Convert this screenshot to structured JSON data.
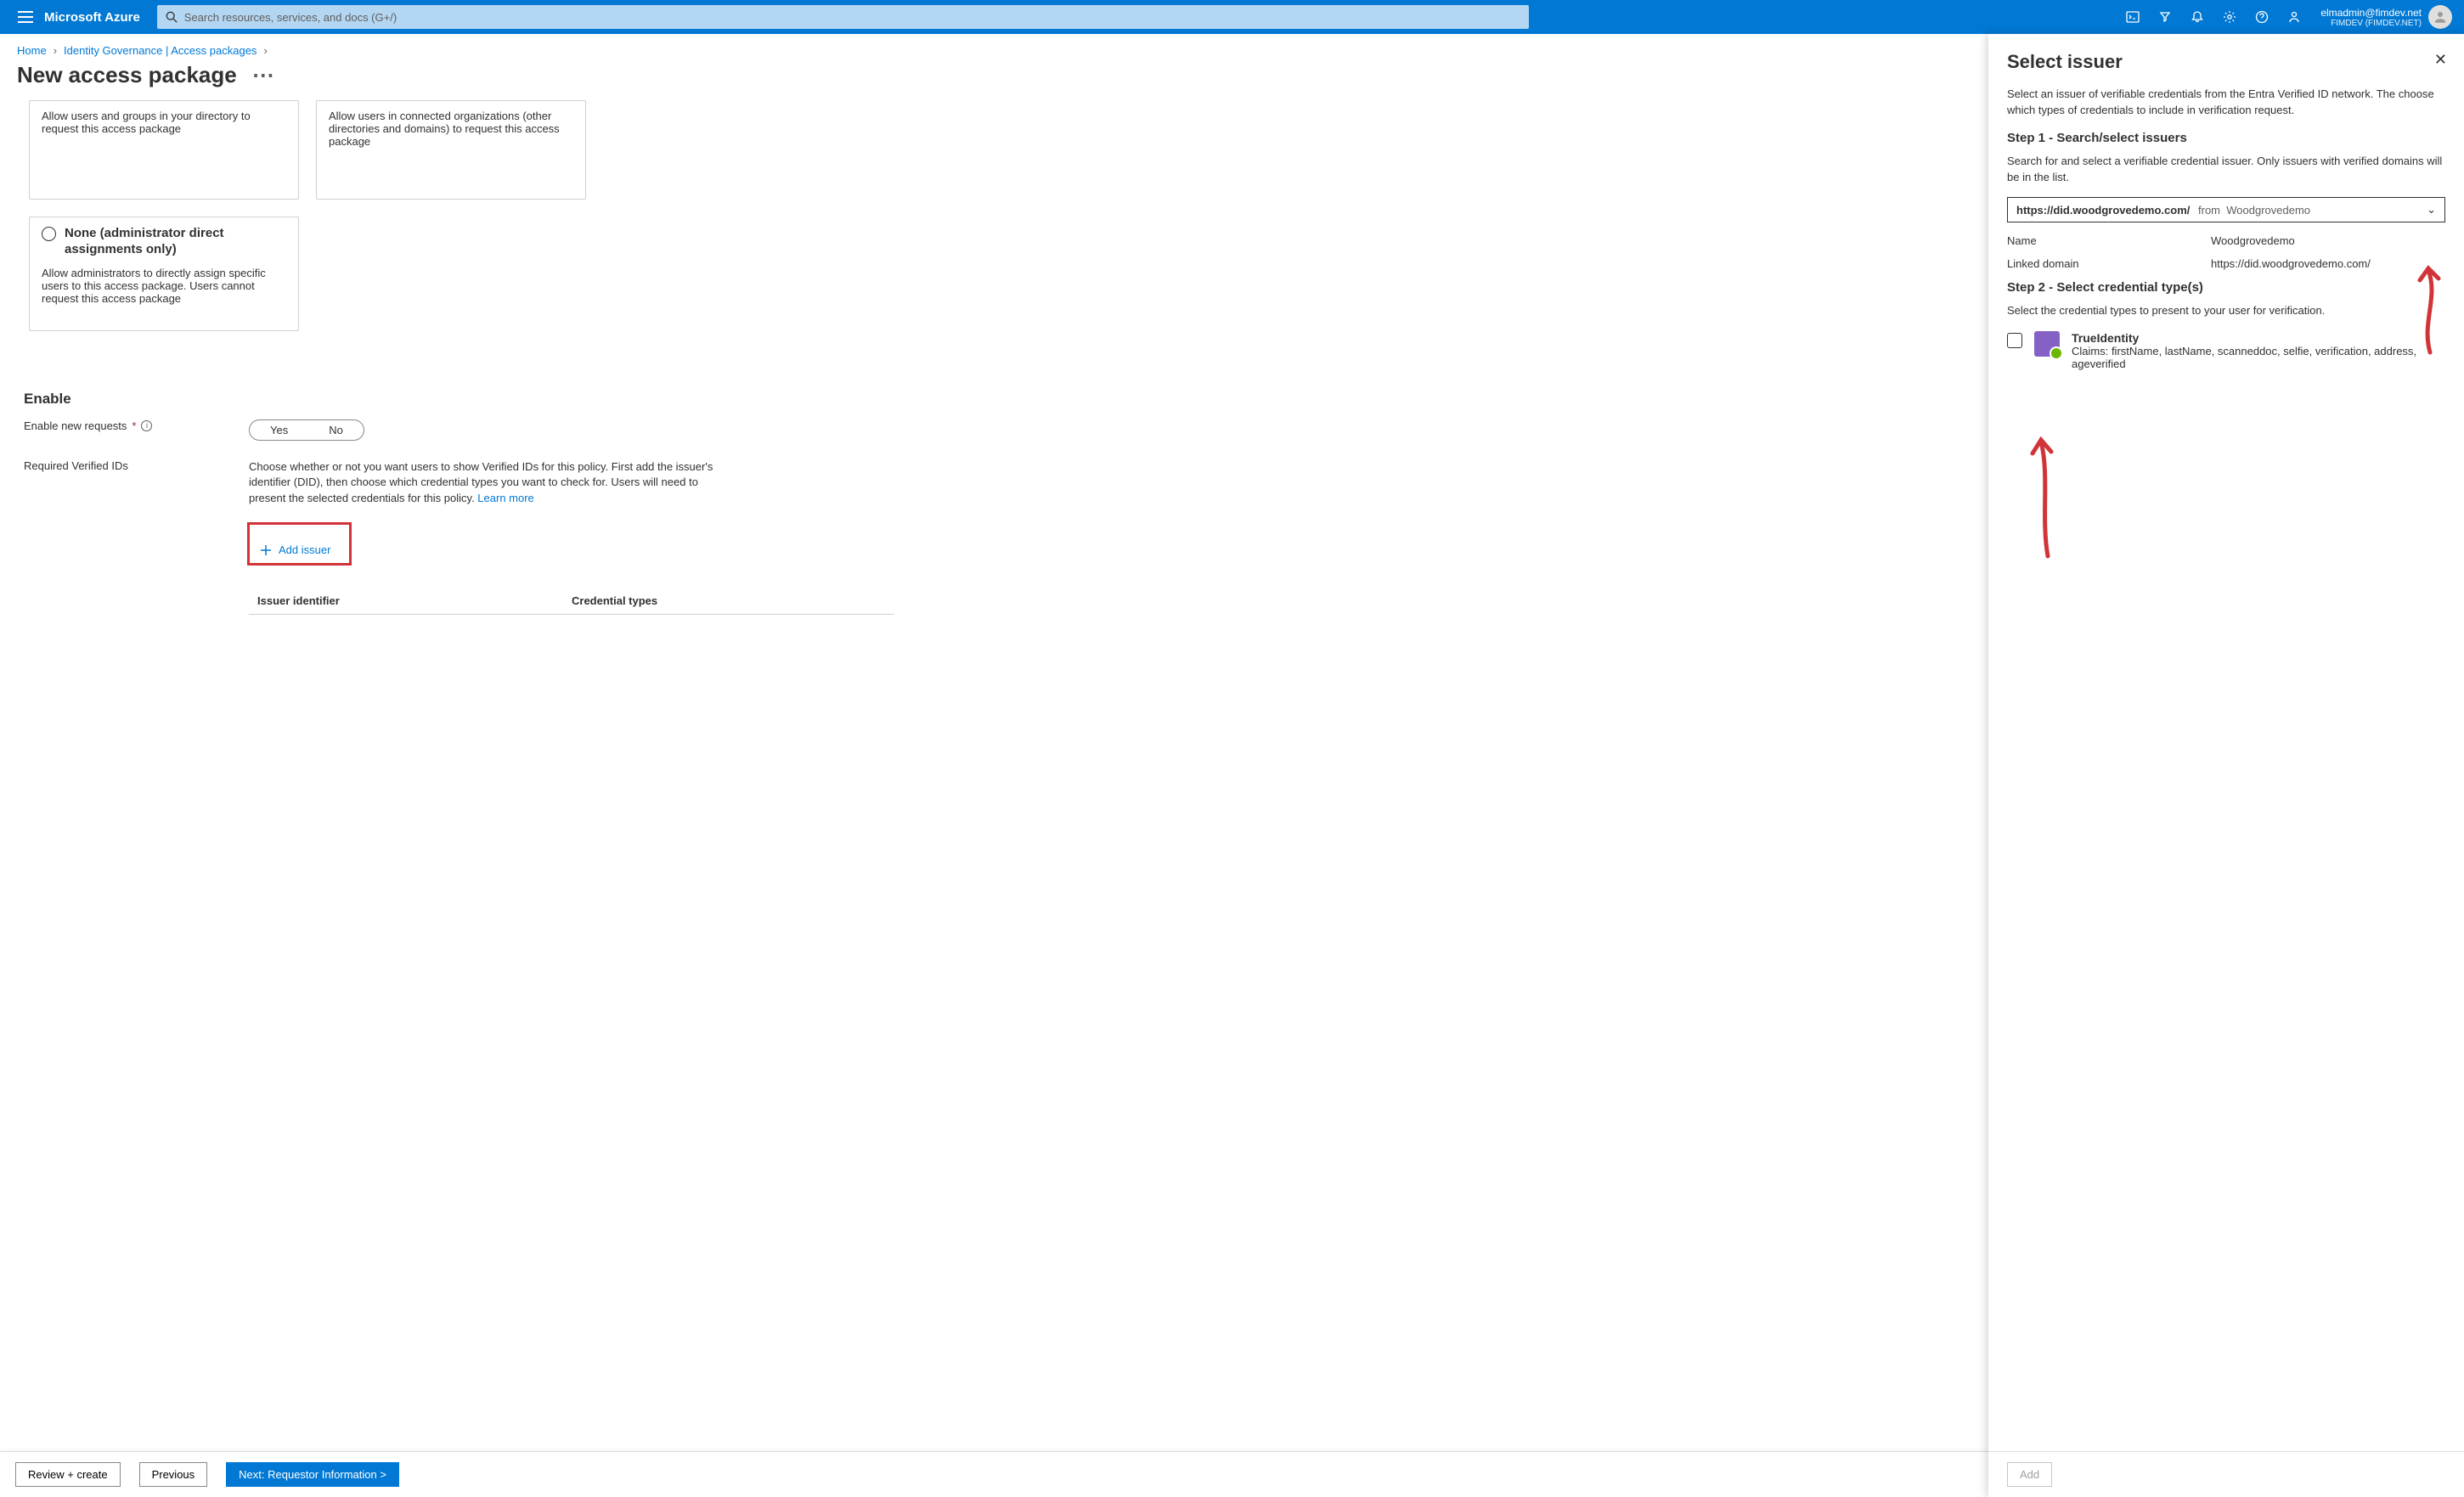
{
  "topbar": {
    "brand": "Microsoft Azure",
    "search_placeholder": "Search resources, services, and docs (G+/)",
    "account_email": "elmadmin@fimdev.net",
    "account_tenant": "FIMDEV (FIMDEV.NET)"
  },
  "breadcrumbs": {
    "home": "Home",
    "l1": "Identity Governance | Access packages"
  },
  "page_title": "New access package",
  "cards": {
    "c1_body": "Allow users and groups in your directory to request this access package",
    "c2_body": "Allow users in connected organizations (other directories and domains) to request this access package",
    "c3_title": "None (administrator direct assignments only)",
    "c3_body": "Allow administrators to directly assign specific users to this access package. Users cannot request this access package"
  },
  "enable": {
    "section": "Enable",
    "row1_label": "Enable new requests",
    "yes": "Yes",
    "no": "No",
    "row2_label": "Required Verified IDs",
    "desc_a": "Choose whether or not you want users to show Verified IDs for this policy. First add the issuer's identifier (DID), then choose which credential types you want to check for. Users will need to present the selected credentials for this policy. ",
    "learn": "Learn more",
    "add_issuer": "Add issuer",
    "col1": "Issuer identifier",
    "col2": "Credential types"
  },
  "footer": {
    "review": "Review + create",
    "prev": "Previous",
    "next": "Next: Requestor Information >"
  },
  "panel": {
    "title": "Select issuer",
    "intro": "Select an issuer of verifiable credentials from the Entra Verified ID network. The choose which types of credentials to include in verification request.",
    "step1": "Step 1 - Search/select issuers",
    "step1_desc": "Search for and select a verifiable credential issuer. Only issuers with verified domains will be in the list.",
    "combo_main": "https://did.woodgrovedemo.com/",
    "combo_from_lbl": "from",
    "combo_from_val": "Woodgrovedemo",
    "name_k": "Name",
    "name_v": "Woodgrovedemo",
    "dom_k": "Linked domain",
    "dom_v": "https://did.woodgrovedemo.com/",
    "step2": "Step 2 - Select credential type(s)",
    "step2_desc": "Select the credential types to present to your user for verification.",
    "cred_title": "TrueIdentity",
    "cred_claims": "Claims: firstName, lastName, scanneddoc, selfie, verification, address, ageverified",
    "add": "Add"
  }
}
